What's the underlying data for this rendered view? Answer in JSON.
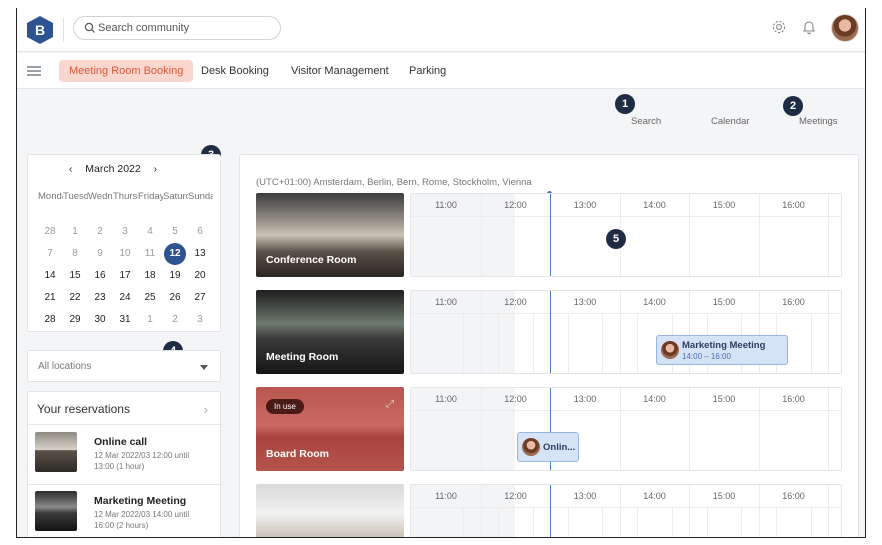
{
  "header": {
    "logo_letter": "B",
    "search_placeholder": "Search community",
    "icons": [
      "gear-icon",
      "bell-icon",
      "user-avatar"
    ],
    "accent": "#2e5391"
  },
  "nav": {
    "tabs": [
      {
        "label": "Meeting Room Booking",
        "active": true
      },
      {
        "label": "Desk Booking",
        "active": false
      },
      {
        "label": "Visitor Management",
        "active": false
      },
      {
        "label": "Parking",
        "active": false
      }
    ]
  },
  "views": {
    "search": "Search",
    "calendar": "Calendar",
    "meetings": "Meetings"
  },
  "badges": [
    "1",
    "2",
    "3",
    "4",
    "5"
  ],
  "calendar": {
    "month_label": "March 2022",
    "prev": "‹",
    "next": "›",
    "weekdays": [
      "Monday",
      "Tuesday",
      "Wednesday",
      "Thursday",
      "Friday",
      "Saturday",
      "Sunday"
    ],
    "weeks": [
      [
        {
          "d": "28",
          "m": true
        },
        {
          "d": "1",
          "m": true
        },
        {
          "d": "2",
          "m": true
        },
        {
          "d": "3",
          "m": true
        },
        {
          "d": "4",
          "m": true
        },
        {
          "d": "5",
          "m": true
        },
        {
          "d": "6",
          "m": true
        }
      ],
      [
        {
          "d": "7",
          "m": true
        },
        {
          "d": "8",
          "m": true
        },
        {
          "d": "9",
          "m": true
        },
        {
          "d": "10",
          "m": true
        },
        {
          "d": "11",
          "m": true
        },
        {
          "d": "12",
          "today": true
        },
        {
          "d": "13"
        }
      ],
      [
        {
          "d": "14"
        },
        {
          "d": "15"
        },
        {
          "d": "16"
        },
        {
          "d": "17"
        },
        {
          "d": "18"
        },
        {
          "d": "19"
        },
        {
          "d": "20"
        }
      ],
      [
        {
          "d": "21"
        },
        {
          "d": "22"
        },
        {
          "d": "23"
        },
        {
          "d": "24"
        },
        {
          "d": "25"
        },
        {
          "d": "26"
        },
        {
          "d": "27"
        }
      ],
      [
        {
          "d": "28"
        },
        {
          "d": "29"
        },
        {
          "d": "30"
        },
        {
          "d": "31"
        },
        {
          "d": "1",
          "m": true
        },
        {
          "d": "2",
          "m": true
        },
        {
          "d": "3",
          "m": true
        }
      ]
    ]
  },
  "locations": {
    "selected": "All locations"
  },
  "reservations": {
    "title": "Your reservations",
    "items": [
      {
        "name": "Online call",
        "line1": "12 Mar 2022/03 12:00 until",
        "line2": "13:00 (1 hour)"
      },
      {
        "name": "Marketing Meeting",
        "line1": "12 Mar 2022/03 14:00 until",
        "line2": "16:00 (2 hours)"
      }
    ]
  },
  "schedule": {
    "timezone": "(UTC+01:00) Amsterdam, Berlin, Bern, Rome, Stockholm, Vienna",
    "hours": [
      "11:00",
      "12:00",
      "13:00",
      "14:00",
      "15:00",
      "16:00"
    ],
    "rooms": [
      {
        "name": "Conference Room",
        "status": ""
      },
      {
        "name": "Meeting Room",
        "status": ""
      },
      {
        "name": "Board Room",
        "status": "In use"
      },
      {
        "name": "",
        "status": ""
      }
    ],
    "bookings": [
      {
        "title": "Marketing Meeting",
        "time": "14:00 – 16:00"
      },
      {
        "title": "Onlin...",
        "time": ""
      }
    ]
  }
}
